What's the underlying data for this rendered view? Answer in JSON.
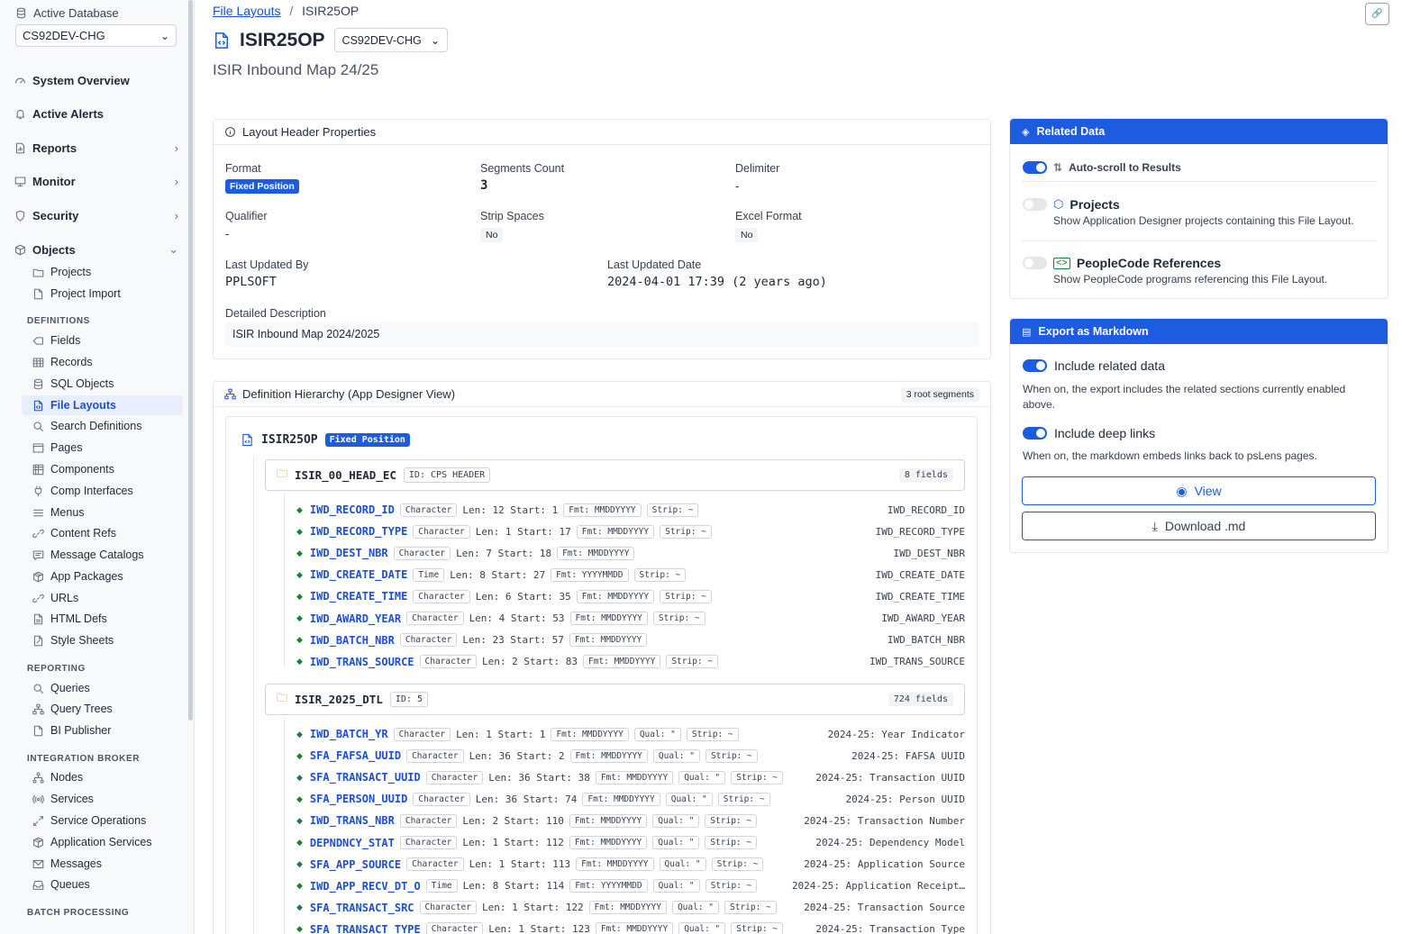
{
  "sidebar": {
    "db_label": "Active Database",
    "db_value": "CS92DEV-CHG",
    "main_items": [
      {
        "label": "System Overview",
        "icon": "gauge-icon",
        "chevron": ""
      },
      {
        "label": "Active Alerts",
        "icon": "bell-icon",
        "chevron": ""
      },
      {
        "label": "Reports",
        "icon": "report-icon",
        "chevron": "›"
      },
      {
        "label": "Monitor",
        "icon": "monitor-icon",
        "chevron": "›"
      },
      {
        "label": "Security",
        "icon": "shield-icon",
        "chevron": "›"
      },
      {
        "label": "Objects",
        "icon": "cube-icon",
        "chevron": "⌄"
      }
    ],
    "object_items": [
      {
        "label": "Projects",
        "icon": "folder-icon"
      },
      {
        "label": "Project Import",
        "icon": "file-icon"
      }
    ],
    "definitions_heading": "DEFINITIONS",
    "definition_items": [
      {
        "label": "Fields",
        "icon": "tag-icon"
      },
      {
        "label": "Records",
        "icon": "table-icon"
      },
      {
        "label": "SQL Objects",
        "icon": "database-icon"
      },
      {
        "label": "File Layouts",
        "icon": "file-code-icon"
      },
      {
        "label": "Search Definitions",
        "icon": "search-icon"
      },
      {
        "label": "Pages",
        "icon": "page-icon"
      },
      {
        "label": "Components",
        "icon": "grid-icon"
      },
      {
        "label": "Comp Interfaces",
        "icon": "plug-icon"
      },
      {
        "label": "Menus",
        "icon": "menu-icon"
      },
      {
        "label": "Content Refs",
        "icon": "link-icon"
      },
      {
        "label": "Message Catalogs",
        "icon": "message-icon"
      },
      {
        "label": "App Packages",
        "icon": "package-icon"
      },
      {
        "label": "URLs",
        "icon": "chain-icon"
      },
      {
        "label": "HTML Defs",
        "icon": "html-icon"
      },
      {
        "label": "Style Sheets",
        "icon": "brush-icon"
      }
    ],
    "reporting_heading": "REPORTING",
    "reporting_items": [
      {
        "label": "Queries",
        "icon": "search-icon"
      },
      {
        "label": "Query Trees",
        "icon": "tree-icon"
      },
      {
        "label": "BI Publisher",
        "icon": "file-icon"
      }
    ],
    "ib_heading": "INTEGRATION BROKER",
    "ib_items": [
      {
        "label": "Nodes",
        "icon": "network-icon"
      },
      {
        "label": "Services",
        "icon": "broadcast-icon"
      },
      {
        "label": "Service Operations",
        "icon": "arrows-icon"
      },
      {
        "label": "Application Services",
        "icon": "package-icon"
      },
      {
        "label": "Messages",
        "icon": "mail-icon"
      },
      {
        "label": "Queues",
        "icon": "inbox-icon"
      }
    ],
    "batch_heading": "BATCH PROCESSING"
  },
  "breadcrumb": {
    "parent": "File Layouts",
    "separator": "/",
    "current": "ISIR25OP"
  },
  "header": {
    "title": "ISIR25OP",
    "env": "CS92DEV-CHG",
    "subtitle": "ISIR Inbound Map 24/25"
  },
  "props": {
    "title": "Layout Header Properties",
    "format_label": "Format",
    "format_value": "Fixed Position",
    "segments_label": "Segments Count",
    "segments_value": "3",
    "delimiter_label": "Delimiter",
    "delimiter_value": "-",
    "qualifier_label": "Qualifier",
    "qualifier_value": "-",
    "strip_label": "Strip Spaces",
    "strip_value": "No",
    "excel_label": "Excel Format",
    "excel_value": "No",
    "updated_by_label": "Last Updated By",
    "updated_by_value": "PPLSOFT",
    "updated_date_label": "Last Updated Date",
    "updated_date_value": "2024-04-01 17:39 (2 years ago)",
    "desc_label": "Detailed Description",
    "desc_value": "ISIR Inbound Map 2024/2025"
  },
  "hierarchy": {
    "title": "Definition Hierarchy (App Designer View)",
    "root_count": "3 root segments",
    "root_name": "ISIR25OP",
    "root_format": "Fixed Position",
    "segments": [
      {
        "name": "ISIR_00_HEAD_EC",
        "id": "ID: CPS HEADER",
        "count": "8 fields",
        "fields": [
          {
            "name": "IWD_RECORD_ID",
            "type": "Character",
            "len": "Len: 12 Start: 1",
            "fmt": "Fmt: MMDDYYYY",
            "qual": "",
            "strip": "Strip: ~",
            "right": "IWD_RECORD_ID"
          },
          {
            "name": "IWD_RECORD_TYPE",
            "type": "Character",
            "len": "Len: 1 Start: 17",
            "fmt": "Fmt: MMDDYYYY",
            "qual": "",
            "strip": "Strip: ~",
            "right": "IWD_RECORD_TYPE"
          },
          {
            "name": "IWD_DEST_NBR",
            "type": "Character",
            "len": "Len: 7 Start: 18",
            "fmt": "Fmt: MMDDYYYY",
            "qual": "",
            "strip": "",
            "right": "IWD_DEST_NBR"
          },
          {
            "name": "IWD_CREATE_DATE",
            "type": "Time",
            "len": "Len: 8 Start: 27",
            "fmt": "Fmt: YYYYMMDD",
            "qual": "",
            "strip": "Strip: ~",
            "right": "IWD_CREATE_DATE"
          },
          {
            "name": "IWD_CREATE_TIME",
            "type": "Character",
            "len": "Len: 6 Start: 35",
            "fmt": "Fmt: MMDDYYYY",
            "qual": "",
            "strip": "Strip: ~",
            "right": "IWD_CREATE_TIME"
          },
          {
            "name": "IWD_AWARD_YEAR",
            "type": "Character",
            "len": "Len: 4 Start: 53",
            "fmt": "Fmt: MMDDYYYY",
            "qual": "",
            "strip": "Strip: ~",
            "right": "IWD_AWARD_YEAR"
          },
          {
            "name": "IWD_BATCH_NBR",
            "type": "Character",
            "len": "Len: 23 Start: 57",
            "fmt": "Fmt: MMDDYYYY",
            "qual": "",
            "strip": "",
            "right": "IWD_BATCH_NBR"
          },
          {
            "name": "IWD_TRANS_SOURCE",
            "type": "Character",
            "len": "Len: 2 Start: 83",
            "fmt": "Fmt: MMDDYYYY",
            "qual": "",
            "strip": "Strip: ~",
            "right": "IWD_TRANS_SOURCE"
          }
        ]
      },
      {
        "name": "ISIR_2025_DTL",
        "id": "ID: 5",
        "count": "724 fields",
        "fields": [
          {
            "name": "IWD_BATCH_YR",
            "type": "Character",
            "len": "Len: 1 Start: 1",
            "fmt": "Fmt: MMDDYYYY",
            "qual": "Qual: \"",
            "strip": "Strip: ~",
            "right": "2024-25: Year Indicator"
          },
          {
            "name": "SFA_FAFSA_UUID",
            "type": "Character",
            "len": "Len: 36 Start: 2",
            "fmt": "Fmt: MMDDYYYY",
            "qual": "Qual: \"",
            "strip": "Strip: ~",
            "right": "2024-25: FAFSA UUID"
          },
          {
            "name": "SFA_TRANSACT_UUID",
            "type": "Character",
            "len": "Len: 36 Start: 38",
            "fmt": "Fmt: MMDDYYYY",
            "qual": "Qual: \"",
            "strip": "Strip: ~",
            "right": "2024-25: Transaction UUID"
          },
          {
            "name": "SFA_PERSON_UUID",
            "type": "Character",
            "len": "Len: 36 Start: 74",
            "fmt": "Fmt: MMDDYYYY",
            "qual": "Qual: \"",
            "strip": "Strip: ~",
            "right": "2024-25: Person UUID"
          },
          {
            "name": "IWD_TRANS_NBR",
            "type": "Character",
            "len": "Len: 2 Start: 110",
            "fmt": "Fmt: MMDDYYYY",
            "qual": "Qual: \"",
            "strip": "Strip: ~",
            "right": "2024-25: Transaction Number"
          },
          {
            "name": "DEPNDNCY_STAT",
            "type": "Character",
            "len": "Len: 1 Start: 112",
            "fmt": "Fmt: MMDDYYYY",
            "qual": "Qual: \"",
            "strip": "Strip: ~",
            "right": "2024-25: Dependency Model"
          },
          {
            "name": "SFA_APP_SOURCE",
            "type": "Character",
            "len": "Len: 1 Start: 113",
            "fmt": "Fmt: MMDDYYYY",
            "qual": "Qual: \"",
            "strip": "Strip: ~",
            "right": "2024-25: Application Source"
          },
          {
            "name": "IWD_APP_RECV_DT_O",
            "type": "Time",
            "len": "Len: 8 Start: 114",
            "fmt": "Fmt: YYYYMMDD",
            "qual": "Qual: \"",
            "strip": "Strip: ~",
            "right": "2024-25: Application Receipt…"
          },
          {
            "name": "SFA_TRANSACT_SRC",
            "type": "Character",
            "len": "Len: 1 Start: 122",
            "fmt": "Fmt: MMDDYYYY",
            "qual": "Qual: \"",
            "strip": "Strip: ~",
            "right": "2024-25: Transaction Source"
          },
          {
            "name": "SFA_TRANSACT_TYPE",
            "type": "Character",
            "len": "Len: 1 Start: 123",
            "fmt": "Fmt: MMDDYYYY",
            "qual": "Qual: \"",
            "strip": "Strip: ~",
            "right": "2024-25: Transaction Type"
          }
        ]
      }
    ]
  },
  "related": {
    "title": "Related Data",
    "autoscroll_label": "Auto-scroll to Results",
    "projects_title": "Projects",
    "projects_desc": "Show Application Designer projects containing this File Layout.",
    "peoplecode_title": "PeopleCode References",
    "peoplecode_desc": "Show PeopleCode programs referencing this File Layout."
  },
  "export": {
    "title": "Export as Markdown",
    "related_label": "Include related data",
    "related_desc": "When on, the export includes the related sections currently enabled above.",
    "links_label": "Include deep links",
    "links_desc": "When on, the markdown embeds links back to psLens pages.",
    "view_label": "View",
    "download_label": "Download .md"
  },
  "colors": {
    "accent": "#1d5be0",
    "link": "#1d4ed8",
    "field_marker": "#15803d"
  }
}
